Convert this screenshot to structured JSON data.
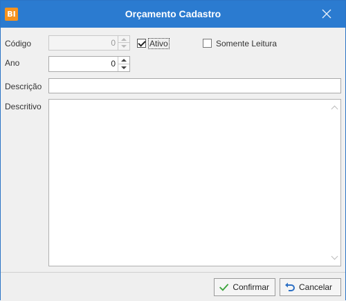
{
  "window": {
    "title": "Orçamento Cadastro",
    "app_icon_text": "BI",
    "close_icon": "close-icon",
    "titlebar_color": "#2b7bd0",
    "app_icon_color": "#f7931e"
  },
  "form": {
    "codigo": {
      "label": "Código",
      "value": "0"
    },
    "ativo": {
      "label": "Ativo",
      "checked": true
    },
    "somente_leitura": {
      "label": "Somente Leitura",
      "checked": false
    },
    "ano": {
      "label": "Ano",
      "value": "0"
    },
    "descricao": {
      "label": "Descrição",
      "value": ""
    },
    "descritivo": {
      "label": "Descritivo",
      "value": ""
    }
  },
  "footer": {
    "confirm_label": "Confirmar",
    "cancel_label": "Cancelar",
    "confirm_icon": "checkmark-icon",
    "cancel_icon": "undo-icon",
    "confirm_icon_color": "#3aa33a",
    "cancel_icon_color": "#2b6fc4"
  }
}
